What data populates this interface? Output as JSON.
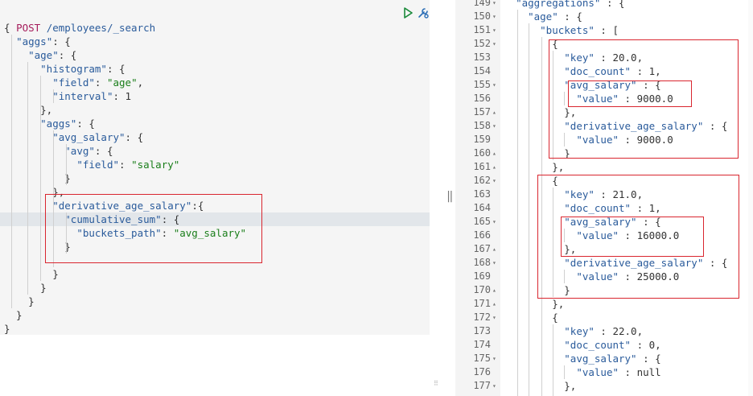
{
  "request": {
    "method": "POST",
    "path": "/employees/_search",
    "lines": [
      "{",
      "  \"aggs\": {",
      "    \"age\": {",
      "      \"histogram\": {",
      "        \"field\": \"age\",",
      "        \"interval\": 1",
      "      },",
      "      \"aggs\": {",
      "        \"avg_salary\": {",
      "          \"avg\": {",
      "            \"field\": \"salary\"",
      "          }",
      "        },",
      "        \"derivative_age_salary\":{",
      "          \"cumulative_sum\": {",
      "            \"buckets_path\": \"avg_salary\"",
      "          }",
      "",
      "        }",
      "      }",
      "    }",
      "  }",
      "}"
    ]
  },
  "response": {
    "line_numbers": [
      "149",
      "150",
      "151",
      "152",
      "153",
      "154",
      "155",
      "156",
      "157",
      "158",
      "159",
      "160",
      "161",
      "162",
      "163",
      "164",
      "165",
      "166",
      "167",
      "168",
      "169",
      "170",
      "171",
      "172",
      "173",
      "174",
      "175",
      "176",
      "177"
    ],
    "folds": [
      "▾",
      "▾",
      "▾",
      "▾",
      "",
      "",
      "▾",
      "",
      "▴",
      "▾",
      "",
      "▴",
      "▴",
      "▾",
      "",
      "",
      "▾",
      "",
      "▴",
      "▾",
      "",
      "▴",
      "▴",
      "▾",
      "",
      "",
      "▾",
      "",
      "▾"
    ],
    "lines": [
      "  \"aggregations\" : {",
      "    \"age\" : {",
      "      \"buckets\" : [",
      "        {",
      "          \"key\" : 20.0,",
      "          \"doc_count\" : 1,",
      "          \"avg_salary\" : {",
      "            \"value\" : 9000.0",
      "          },",
      "          \"derivative_age_salary\" : {",
      "            \"value\" : 9000.0",
      "          }",
      "        },",
      "        {",
      "          \"key\" : 21.0,",
      "          \"doc_count\" : 1,",
      "          \"avg_salary\" : {",
      "            \"value\" : 16000.0",
      "          },",
      "          \"derivative_age_salary\" : {",
      "            \"value\" : 25000.0",
      "          }",
      "        },",
      "        {",
      "          \"key\" : 22.0,",
      "          \"doc_count\" : 0,",
      "          \"avg_salary\" : {",
      "            \"value\" : null",
      "          },"
    ]
  },
  "colors": {
    "string": "#1a7e1a",
    "key": "#2a5b9b",
    "method": "#a51c5b",
    "highlight_box": "#d9262f",
    "active_line": "#e2e6ea"
  },
  "icons": {
    "run": "play-icon",
    "settings": "wrench-icon",
    "splitter": "splitter-handle-icon"
  }
}
